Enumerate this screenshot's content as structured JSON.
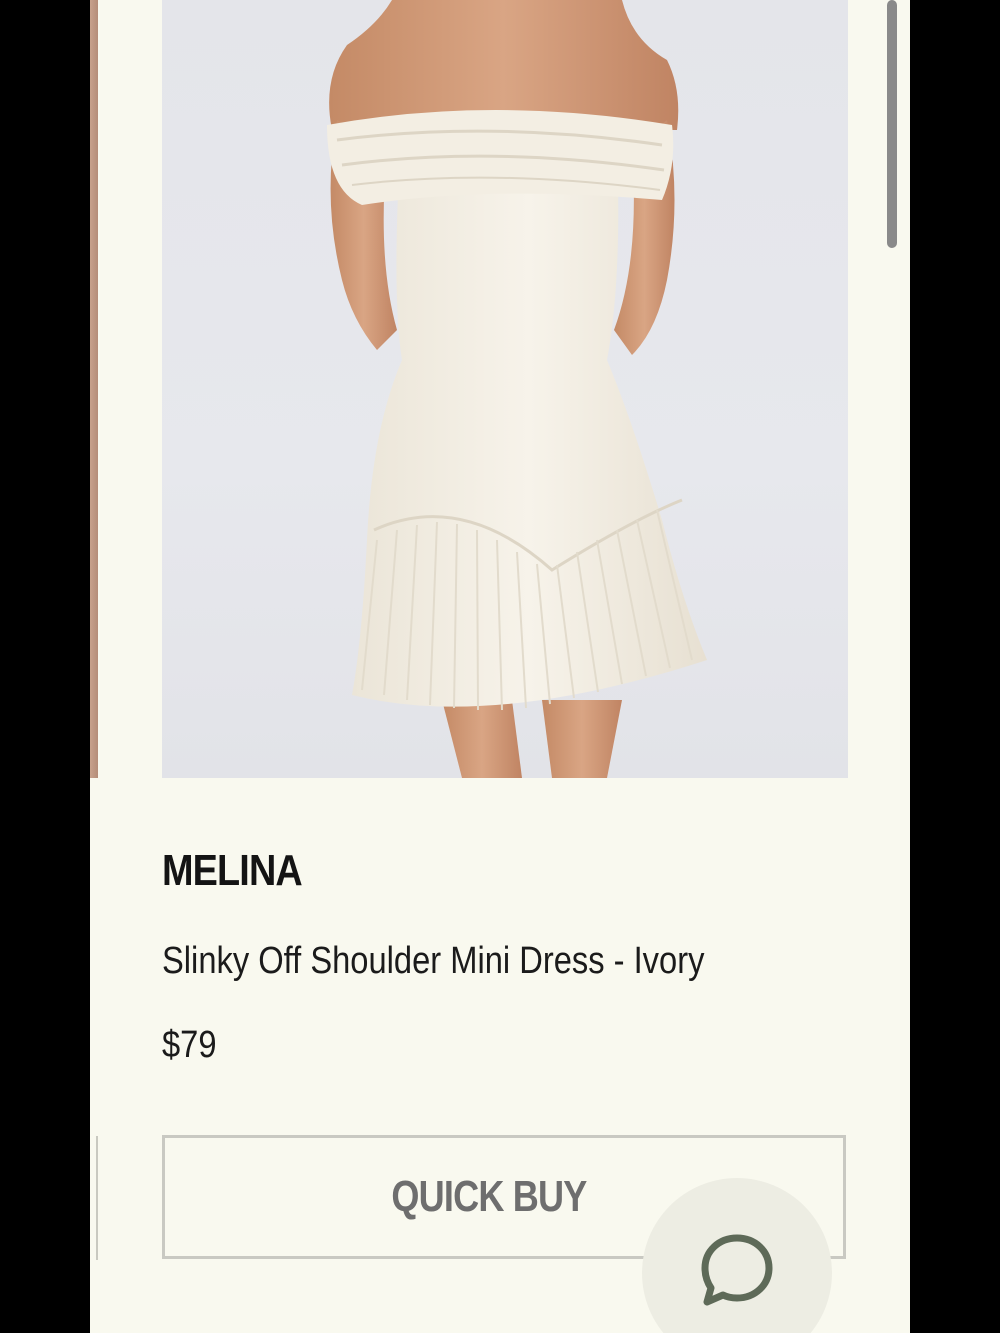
{
  "product": {
    "brand": "MELINA",
    "name": "Slinky Off Shoulder Mini Dress - Ivory",
    "price": "$79",
    "image_alt": "Model wearing ivory off-shoulder mini dress with pleated hem"
  },
  "actions": {
    "quick_buy_label": "QUICK BUY",
    "chat_icon": "chat-bubble-icon"
  },
  "colors": {
    "page_background": "#f9f9ef",
    "text": "#141414",
    "button_border": "#c9c9c2",
    "chat_button": "#edede3",
    "chat_icon": "#5e6a58"
  }
}
